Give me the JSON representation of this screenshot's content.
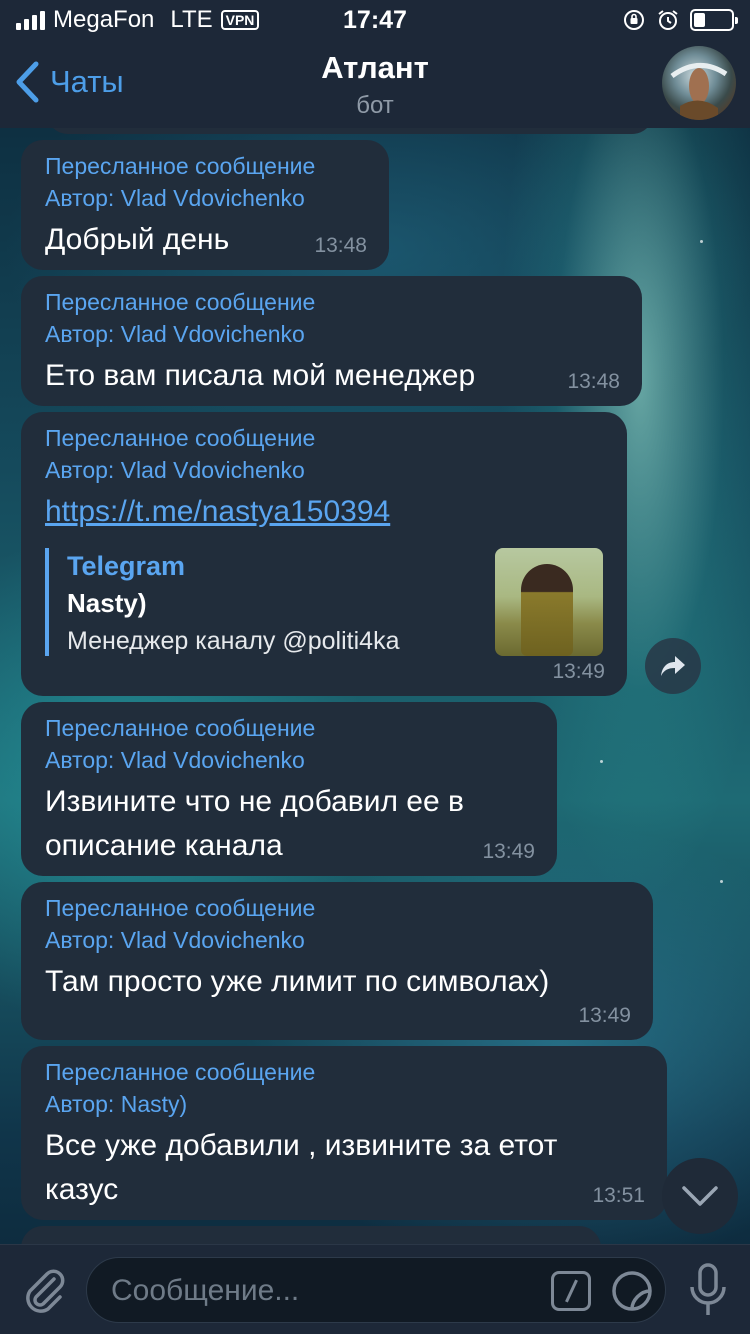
{
  "status_bar": {
    "carrier": "MegaFon",
    "network": "LTE",
    "vpn": "VPN",
    "time": "17:47",
    "battery_level": 0.3
  },
  "header": {
    "back_label": "Чаты",
    "title": "Атлант",
    "subtitle": "бот"
  },
  "messages": [
    {
      "fwd_label": "Пересланное сообщение",
      "fwd_prefix": "Автор: ",
      "fwd_author": "Vlad Vdovichenko",
      "text": "Добрый день",
      "time": "13:48"
    },
    {
      "fwd_label": "Пересланное сообщение",
      "fwd_prefix": "Автор: ",
      "fwd_author": "Vlad Vdovichenko",
      "text": "Ето вам писала мой менеджер",
      "time": "13:48"
    },
    {
      "fwd_label": "Пересланное сообщение",
      "fwd_prefix": "Автор: ",
      "fwd_author": "Vlad Vdovichenko",
      "link": "https://t.me/nastya150394",
      "preview": {
        "site": "Telegram",
        "title": "Nasty)",
        "description": "Менеджер каналу @politi4ka"
      },
      "time": "13:49"
    },
    {
      "fwd_label": "Пересланное сообщение",
      "fwd_prefix": "Автор: ",
      "fwd_author": "Vlad Vdovichenko",
      "text_line1": "Извините  что не добавил ее в",
      "text_line2": "описание канала",
      "time": "13:49"
    },
    {
      "fwd_label": "Пересланное сообщение",
      "fwd_prefix": "Автор: ",
      "fwd_author": "Vlad Vdovichenko",
      "text": "Там просто уже лимит по символах)",
      "time": "13:49"
    },
    {
      "fwd_label": "Пересланное сообщение",
      "fwd_prefix": "Автор: ",
      "fwd_author": "Nasty)",
      "text_line1": "Все уже добавили  , извините за етот",
      "text_line2": "казус",
      "time": "13:51"
    }
  ],
  "composer": {
    "placeholder": "Сообщение..."
  },
  "icons": {
    "back": "chevron-left-icon",
    "share": "share-arrow-icon",
    "scroll_down": "chevron-down-icon",
    "attach": "paperclip-icon",
    "commands": "slash-command-icon",
    "sticker": "sticker-icon",
    "mic": "microphone-icon"
  },
  "colors": {
    "accent": "#5aa5f0",
    "bubble": "#212d3b",
    "bar": "#1d2838"
  }
}
